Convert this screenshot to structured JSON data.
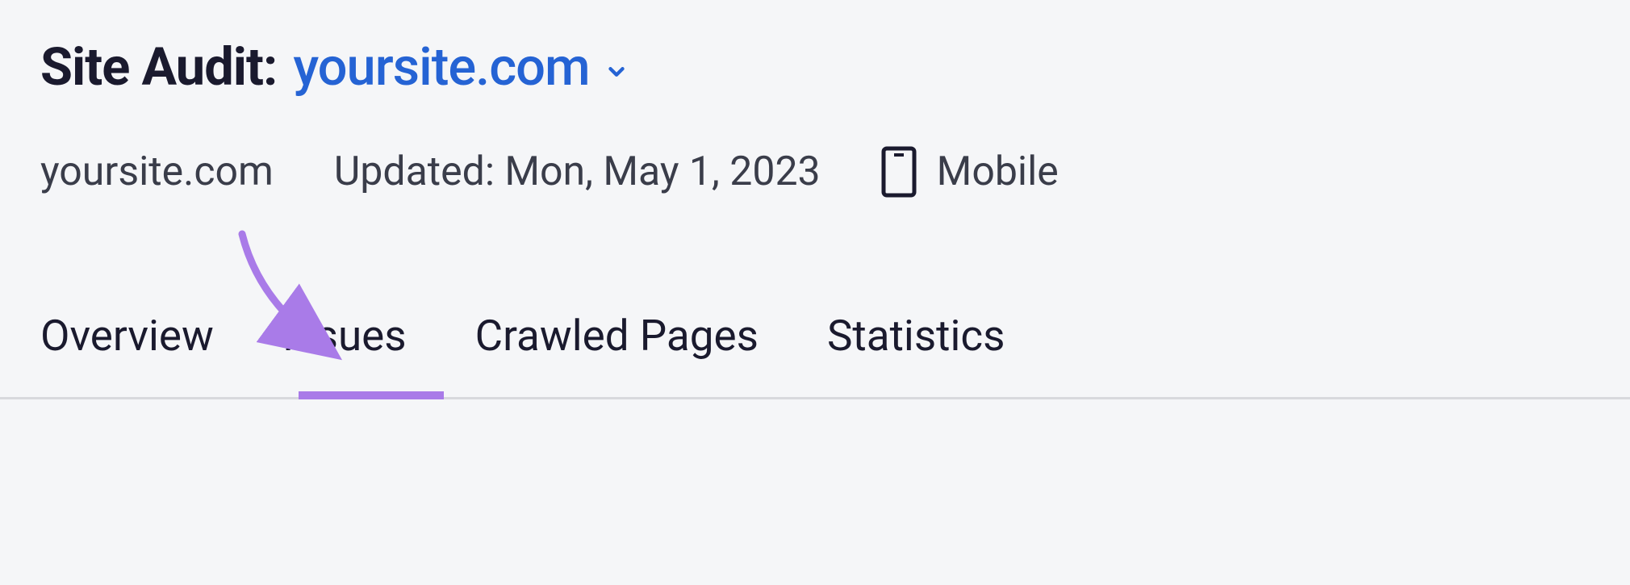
{
  "header": {
    "title_prefix": "Site Audit:",
    "domain": "yoursite.com"
  },
  "meta": {
    "domain": "yoursite.com",
    "updated": "Updated: Mon, May 1, 2023",
    "device": "Mobile"
  },
  "tabs": {
    "overview": "Overview",
    "issues": "Issues",
    "crawled": "Crawled Pages",
    "statistics": "Statistics"
  },
  "colors": {
    "accent_blue": "#2563d4",
    "annotation_purple": "#a97be8"
  }
}
